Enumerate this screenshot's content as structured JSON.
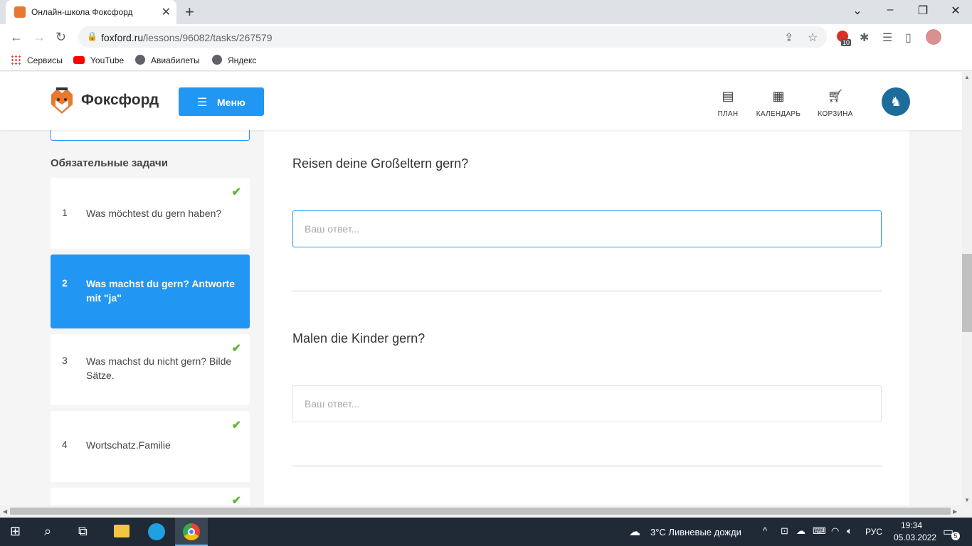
{
  "browser": {
    "tab_title": "Онлайн-школа Фоксфорд",
    "url_host": "foxford.ru",
    "url_path": "/lessons/96082/tasks/267579",
    "extension_badge": "10",
    "bookmarks": [
      "Сервисы",
      "YouTube",
      "Авиабилеты",
      "Яндекс"
    ]
  },
  "header": {
    "logo_text": "Фоксфорд",
    "menu_label": "Меню",
    "nav": [
      {
        "label": "ПЛАН",
        "icon": "plan-icon"
      },
      {
        "label": "КАЛЕНДАРЬ",
        "icon": "calendar-icon"
      },
      {
        "label": "КОРЗИНА",
        "icon": "cart-icon"
      }
    ]
  },
  "sidebar": {
    "heading": "Обязательные задачи",
    "tasks": [
      {
        "num": "1",
        "text": "Was möchtest du gern haben?",
        "done": true,
        "active": false
      },
      {
        "num": "2",
        "text": "Was machst du gern? Antworte mit \"ja\"",
        "done": false,
        "active": true
      },
      {
        "num": "3",
        "text": "Was machst du nicht gern? Bilde Sätze.",
        "done": true,
        "active": false
      },
      {
        "num": "4",
        "text": "Wortschatz.Familie",
        "done": true,
        "active": false
      }
    ]
  },
  "questions": [
    {
      "text": "Reisen deine Großeltern gern?",
      "placeholder": "Ваш ответ..."
    },
    {
      "text": "Malen die Kinder gern?",
      "placeholder": "Ваш ответ..."
    }
  ],
  "taskbar": {
    "weather": "3°C  Ливневые дожди",
    "lang": "РУС",
    "time": "19:34",
    "date": "05.03.2022",
    "notifications": "5"
  },
  "colors": {
    "accent": "#2196f3",
    "check": "#5cb82e"
  }
}
